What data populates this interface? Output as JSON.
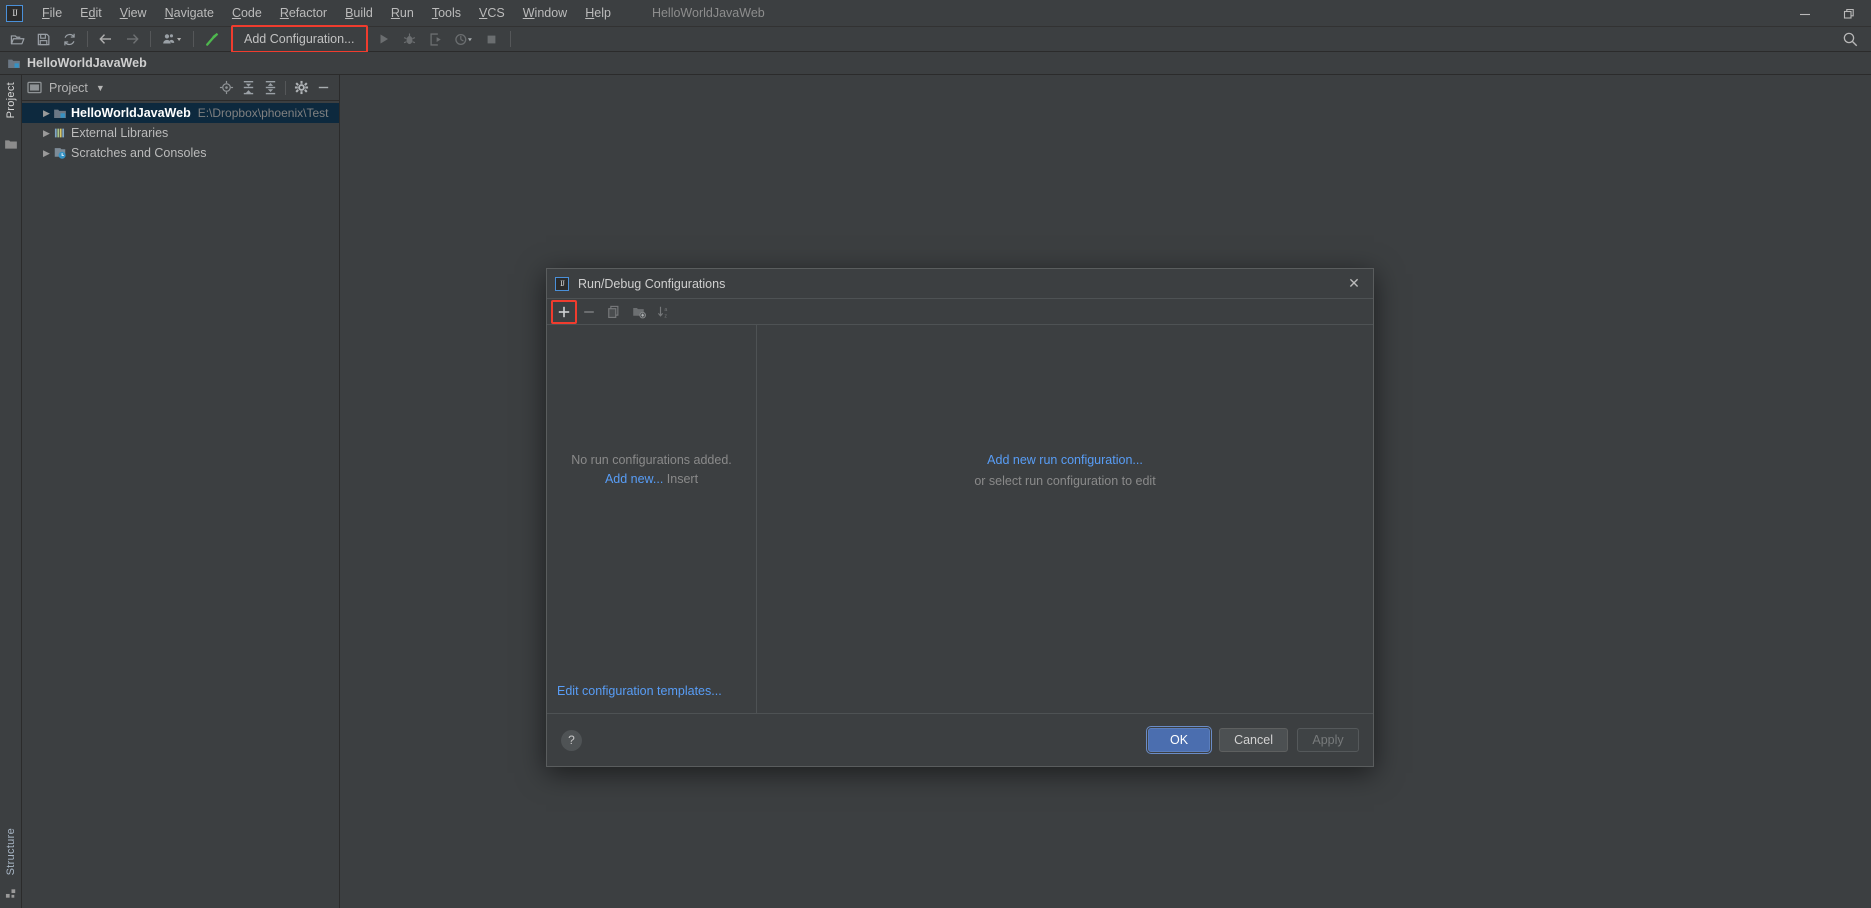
{
  "window": {
    "title": "HelloWorldJavaWeb",
    "minimize_label": "—",
    "restore_label": "❐"
  },
  "menubar": {
    "items": [
      {
        "label": "File",
        "mnemonic": "F"
      },
      {
        "label": "Edit",
        "mnemonic": "E"
      },
      {
        "label": "View",
        "mnemonic": "V"
      },
      {
        "label": "Navigate",
        "mnemonic": "N"
      },
      {
        "label": "Code",
        "mnemonic": "C"
      },
      {
        "label": "Refactor",
        "mnemonic": "R"
      },
      {
        "label": "Build",
        "mnemonic": "B"
      },
      {
        "label": "Run",
        "mnemonic": "R"
      },
      {
        "label": "Tools",
        "mnemonic": "T"
      },
      {
        "label": "VCS",
        "mnemonic": "V"
      },
      {
        "label": "Window",
        "mnemonic": "W"
      },
      {
        "label": "Help",
        "mnemonic": "H"
      }
    ]
  },
  "toolbar": {
    "open_tooltip": "Open",
    "save_tooltip": "Save All",
    "sync_tooltip": "Synchronize",
    "back_tooltip": "Back",
    "forward_tooltip": "Forward",
    "profile_tooltip": "Select Run/Debug Configuration",
    "build_tooltip": "Build Project",
    "add_configuration": "Add Configuration...",
    "run_tooltip": "Run",
    "debug_tooltip": "Debug",
    "run_coverage_tooltip": "Run with Coverage",
    "profiler_tooltip": "Profiler",
    "stop_tooltip": "Stop",
    "search_tooltip": "Search Everywhere",
    "highlight_color": "#f03c2e"
  },
  "navbar": {
    "breadcrumb": "HelloWorldJavaWeb"
  },
  "stripe": {
    "left_top": "Project",
    "left_bottom": "Structure"
  },
  "project_panel": {
    "title": "Project",
    "dropdown_icon": "chevron-down-icon",
    "icons": [
      {
        "name": "locate-icon",
        "tooltip": "Select Opened File"
      },
      {
        "name": "expand-all-icon",
        "tooltip": "Expand All"
      },
      {
        "name": "collapse-all-icon",
        "tooltip": "Collapse All"
      },
      {
        "name": "gear-icon",
        "tooltip": "Show Options Menu"
      },
      {
        "name": "hide-icon",
        "tooltip": "Hide"
      }
    ],
    "tree": [
      {
        "label": "HelloWorldJavaWeb",
        "path": "E:\\Dropbox\\phoenix\\Test",
        "icon": "module-icon",
        "selected": true,
        "expandable": true
      },
      {
        "label": "External Libraries",
        "path": "",
        "icon": "libraries-icon",
        "selected": false,
        "expandable": true
      },
      {
        "label": "Scratches and Consoles",
        "path": "",
        "icon": "scratches-icon",
        "selected": false,
        "expandable": true
      }
    ]
  },
  "dialog": {
    "title": "Run/Debug Configurations",
    "close_label": "✕",
    "toolbar": [
      {
        "name": "add-configuration-button",
        "glyph": "+",
        "enabled": true,
        "highlighted": true
      },
      {
        "name": "remove-configuration-button",
        "glyph": "−",
        "enabled": false,
        "highlighted": false
      },
      {
        "name": "copy-configuration-button",
        "glyph": "copy-icon",
        "enabled": false,
        "highlighted": false
      },
      {
        "name": "save-configuration-button",
        "glyph": "folder-add-icon",
        "enabled": false,
        "highlighted": false
      },
      {
        "name": "sort-configurations-button",
        "glyph": "sort-az-icon",
        "enabled": false,
        "highlighted": false
      }
    ],
    "left_panel": {
      "empty_text": "No run configurations added.",
      "add_new_link": "Add new...",
      "add_new_shortcut": "Insert",
      "edit_templates_link": "Edit configuration templates..."
    },
    "right_panel": {
      "add_new_link": "Add new run configuration...",
      "hint": "or select run configuration to edit"
    },
    "footer": {
      "help_label": "?",
      "ok_label": "OK",
      "cancel_label": "Cancel",
      "apply_label": "Apply"
    }
  },
  "colors": {
    "background": "#3c3f41",
    "panel": "#3c3f41",
    "selection": "#0d293e",
    "link": "#589df6",
    "primary_button": "#4b6eaf",
    "highlight": "#f03c2e",
    "text": "#bbbbbb",
    "muted_text": "#808080"
  }
}
